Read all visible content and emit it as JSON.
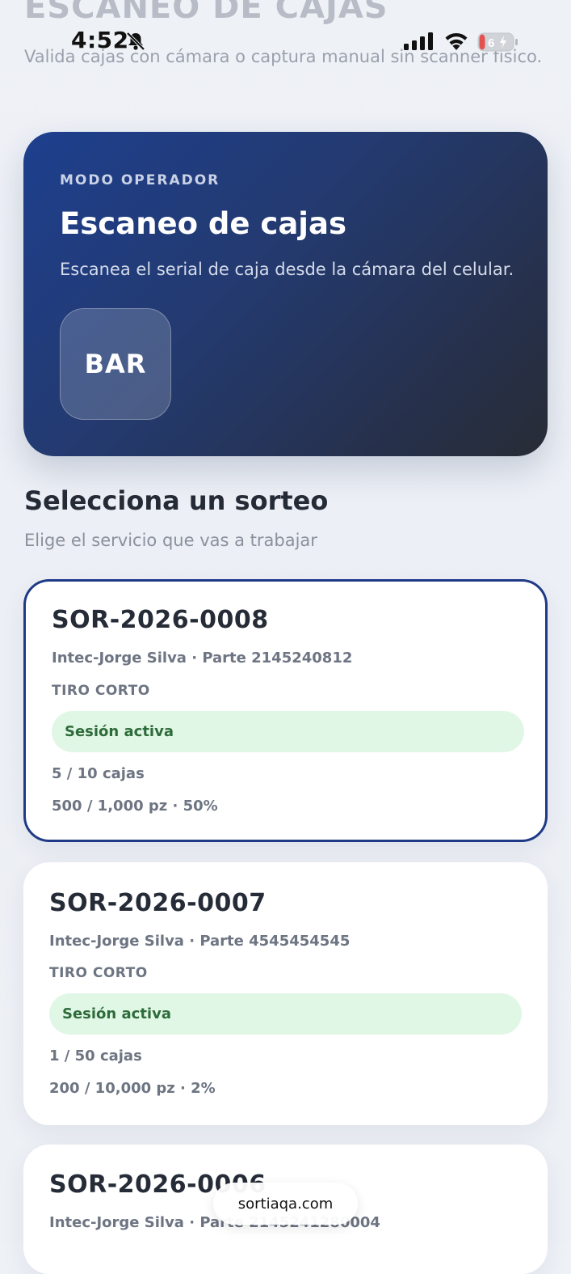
{
  "status_bar": {
    "time": "4:52",
    "battery": "6"
  },
  "page_header": {
    "title": "ESCANEO DE CAJAS",
    "subtitle": "Valida cajas con cámara o captura manual sin scanner físico."
  },
  "hero": {
    "eyebrow": "MODO OPERADOR",
    "title": "Escaneo de cajas",
    "subtitle": "Escanea el serial de caja desde la cámara del celular.",
    "button_label": "BAR"
  },
  "section": {
    "title": "Selecciona un sorteo",
    "subtitle": "Elige el servicio que vas a trabajar"
  },
  "sorteos": [
    {
      "id": "SOR-2026-0008",
      "client": "Intec-Jorge Silva · Parte 2145240812",
      "type": "TIRO CORTO",
      "status": "Sesión activa",
      "boxes": "5 / 10 cajas",
      "pieces": "500 / 1,000 pz · 50%"
    },
    {
      "id": "SOR-2026-0007",
      "client": "Intec-Jorge Silva · Parte 4545454545",
      "type": "TIRO CORTO",
      "status": "Sesión activa",
      "boxes": "1 / 50 cajas",
      "pieces": "200 / 10,000 pz · 2%"
    },
    {
      "id": "SOR-2026-0006",
      "client": "Intec-Jorge Silva · Parte 2145241280004"
    }
  ],
  "browser": {
    "url": "sortiaqa.com"
  },
  "colors": {
    "accent": "#1f3a86",
    "badge_bg": "#e1f7e6",
    "badge_text": "#2e6b3a"
  }
}
